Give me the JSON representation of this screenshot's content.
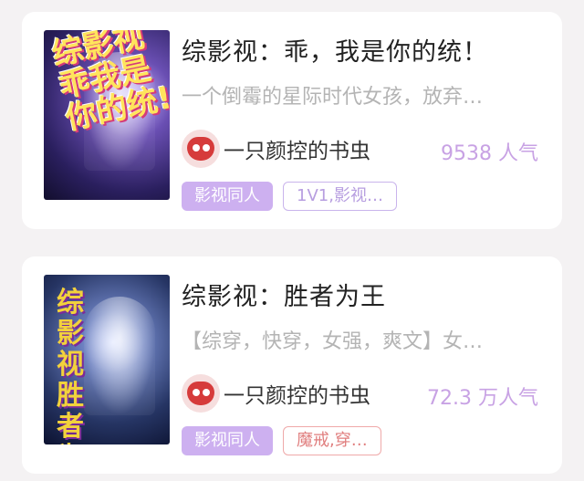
{
  "books": [
    {
      "title": "综影视：乖，我是你的统！",
      "intro": "一个倒霉的星际时代女孩，放弃…",
      "cover_text": "综影视乖我是你的统!",
      "author": "一只颜控的书虫",
      "popularity": "9538 人气",
      "category_tag": "影视同人",
      "keyword_tag": "1V1,影视…",
      "keyword_color": "#b79ee0"
    },
    {
      "title": "综影视：胜者为王",
      "intro": "【综穿，快穿，女强，爽文】女…",
      "cover_text": "综影视胜者为王",
      "author": "一只颜控的书虫",
      "popularity": "72.3 万人气",
      "category_tag": "影视同人",
      "keyword_tag": "魔戒,穿…",
      "keyword_color": "#e07e7e"
    }
  ]
}
